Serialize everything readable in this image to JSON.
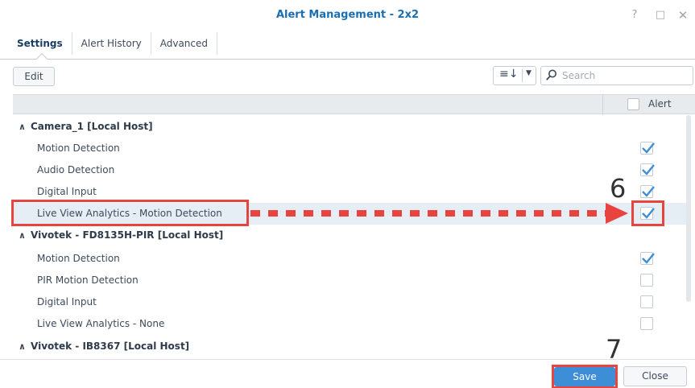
{
  "window": {
    "title": "Alert Management - 2x2",
    "controls": {
      "help": "?",
      "maximize": "□",
      "close": "✕"
    }
  },
  "tabs": [
    {
      "label": "Settings",
      "active": true
    },
    {
      "label": "Alert History",
      "active": false
    },
    {
      "label": "Advanced",
      "active": false
    }
  ],
  "toolbar": {
    "edit_label": "Edit",
    "sort_icon": "sort-icon",
    "search": {
      "placeholder": "Search",
      "value": ""
    }
  },
  "grid": {
    "column_alert": "Alert",
    "groups": [
      {
        "label": "Camera_1 [Local Host]",
        "items": [
          {
            "label": "Motion Detection",
            "alert": true
          },
          {
            "label": "Audio Detection",
            "alert": true
          },
          {
            "label": "Digital Input",
            "alert": true
          },
          {
            "label": "Live View Analytics - Motion Detection",
            "alert": true,
            "selected": true
          }
        ]
      },
      {
        "label": "Vivotek - FD8135H-PIR [Local Host]",
        "items": [
          {
            "label": "Motion Detection",
            "alert": true
          },
          {
            "label": "PIR Motion Detection",
            "alert": false
          },
          {
            "label": "Digital Input",
            "alert": false
          },
          {
            "label": "Live View Analytics - None",
            "alert": false
          }
        ]
      },
      {
        "label": "Vivotek - IB8367 [Local Host]",
        "items": []
      }
    ]
  },
  "footer": {
    "save_label": "Save",
    "close_label": "Close"
  },
  "annotations": {
    "step_6": "6",
    "step_7": "7",
    "color": "#e8433f"
  },
  "colors": {
    "accent": "#3e8ed7",
    "title": "#1a6fb3",
    "check": "#3e8ed7"
  }
}
